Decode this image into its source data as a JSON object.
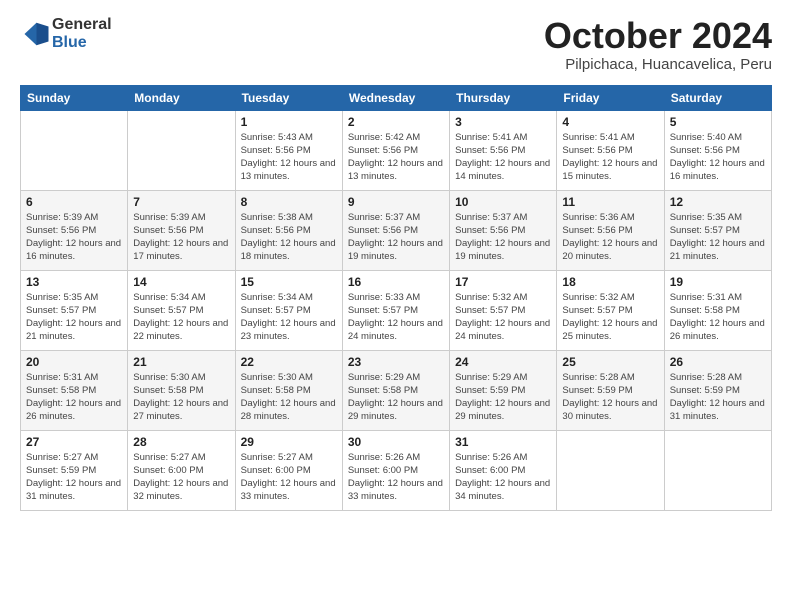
{
  "header": {
    "logo_general": "General",
    "logo_blue": "Blue",
    "month": "October 2024",
    "location": "Pilpichaca, Huancavelica, Peru"
  },
  "weekdays": [
    "Sunday",
    "Monday",
    "Tuesday",
    "Wednesday",
    "Thursday",
    "Friday",
    "Saturday"
  ],
  "weeks": [
    [
      {
        "day": "",
        "info": ""
      },
      {
        "day": "",
        "info": ""
      },
      {
        "day": "1",
        "info": "Sunrise: 5:43 AM\nSunset: 5:56 PM\nDaylight: 12 hours and 13 minutes."
      },
      {
        "day": "2",
        "info": "Sunrise: 5:42 AM\nSunset: 5:56 PM\nDaylight: 12 hours and 13 minutes."
      },
      {
        "day": "3",
        "info": "Sunrise: 5:41 AM\nSunset: 5:56 PM\nDaylight: 12 hours and 14 minutes."
      },
      {
        "day": "4",
        "info": "Sunrise: 5:41 AM\nSunset: 5:56 PM\nDaylight: 12 hours and 15 minutes."
      },
      {
        "day": "5",
        "info": "Sunrise: 5:40 AM\nSunset: 5:56 PM\nDaylight: 12 hours and 16 minutes."
      }
    ],
    [
      {
        "day": "6",
        "info": "Sunrise: 5:39 AM\nSunset: 5:56 PM\nDaylight: 12 hours and 16 minutes."
      },
      {
        "day": "7",
        "info": "Sunrise: 5:39 AM\nSunset: 5:56 PM\nDaylight: 12 hours and 17 minutes."
      },
      {
        "day": "8",
        "info": "Sunrise: 5:38 AM\nSunset: 5:56 PM\nDaylight: 12 hours and 18 minutes."
      },
      {
        "day": "9",
        "info": "Sunrise: 5:37 AM\nSunset: 5:56 PM\nDaylight: 12 hours and 19 minutes."
      },
      {
        "day": "10",
        "info": "Sunrise: 5:37 AM\nSunset: 5:56 PM\nDaylight: 12 hours and 19 minutes."
      },
      {
        "day": "11",
        "info": "Sunrise: 5:36 AM\nSunset: 5:56 PM\nDaylight: 12 hours and 20 minutes."
      },
      {
        "day": "12",
        "info": "Sunrise: 5:35 AM\nSunset: 5:57 PM\nDaylight: 12 hours and 21 minutes."
      }
    ],
    [
      {
        "day": "13",
        "info": "Sunrise: 5:35 AM\nSunset: 5:57 PM\nDaylight: 12 hours and 21 minutes."
      },
      {
        "day": "14",
        "info": "Sunrise: 5:34 AM\nSunset: 5:57 PM\nDaylight: 12 hours and 22 minutes."
      },
      {
        "day": "15",
        "info": "Sunrise: 5:34 AM\nSunset: 5:57 PM\nDaylight: 12 hours and 23 minutes."
      },
      {
        "day": "16",
        "info": "Sunrise: 5:33 AM\nSunset: 5:57 PM\nDaylight: 12 hours and 24 minutes."
      },
      {
        "day": "17",
        "info": "Sunrise: 5:32 AM\nSunset: 5:57 PM\nDaylight: 12 hours and 24 minutes."
      },
      {
        "day": "18",
        "info": "Sunrise: 5:32 AM\nSunset: 5:57 PM\nDaylight: 12 hours and 25 minutes."
      },
      {
        "day": "19",
        "info": "Sunrise: 5:31 AM\nSunset: 5:58 PM\nDaylight: 12 hours and 26 minutes."
      }
    ],
    [
      {
        "day": "20",
        "info": "Sunrise: 5:31 AM\nSunset: 5:58 PM\nDaylight: 12 hours and 26 minutes."
      },
      {
        "day": "21",
        "info": "Sunrise: 5:30 AM\nSunset: 5:58 PM\nDaylight: 12 hours and 27 minutes."
      },
      {
        "day": "22",
        "info": "Sunrise: 5:30 AM\nSunset: 5:58 PM\nDaylight: 12 hours and 28 minutes."
      },
      {
        "day": "23",
        "info": "Sunrise: 5:29 AM\nSunset: 5:58 PM\nDaylight: 12 hours and 29 minutes."
      },
      {
        "day": "24",
        "info": "Sunrise: 5:29 AM\nSunset: 5:59 PM\nDaylight: 12 hours and 29 minutes."
      },
      {
        "day": "25",
        "info": "Sunrise: 5:28 AM\nSunset: 5:59 PM\nDaylight: 12 hours and 30 minutes."
      },
      {
        "day": "26",
        "info": "Sunrise: 5:28 AM\nSunset: 5:59 PM\nDaylight: 12 hours and 31 minutes."
      }
    ],
    [
      {
        "day": "27",
        "info": "Sunrise: 5:27 AM\nSunset: 5:59 PM\nDaylight: 12 hours and 31 minutes."
      },
      {
        "day": "28",
        "info": "Sunrise: 5:27 AM\nSunset: 6:00 PM\nDaylight: 12 hours and 32 minutes."
      },
      {
        "day": "29",
        "info": "Sunrise: 5:27 AM\nSunset: 6:00 PM\nDaylight: 12 hours and 33 minutes."
      },
      {
        "day": "30",
        "info": "Sunrise: 5:26 AM\nSunset: 6:00 PM\nDaylight: 12 hours and 33 minutes."
      },
      {
        "day": "31",
        "info": "Sunrise: 5:26 AM\nSunset: 6:00 PM\nDaylight: 12 hours and 34 minutes."
      },
      {
        "day": "",
        "info": ""
      },
      {
        "day": "",
        "info": ""
      }
    ]
  ]
}
